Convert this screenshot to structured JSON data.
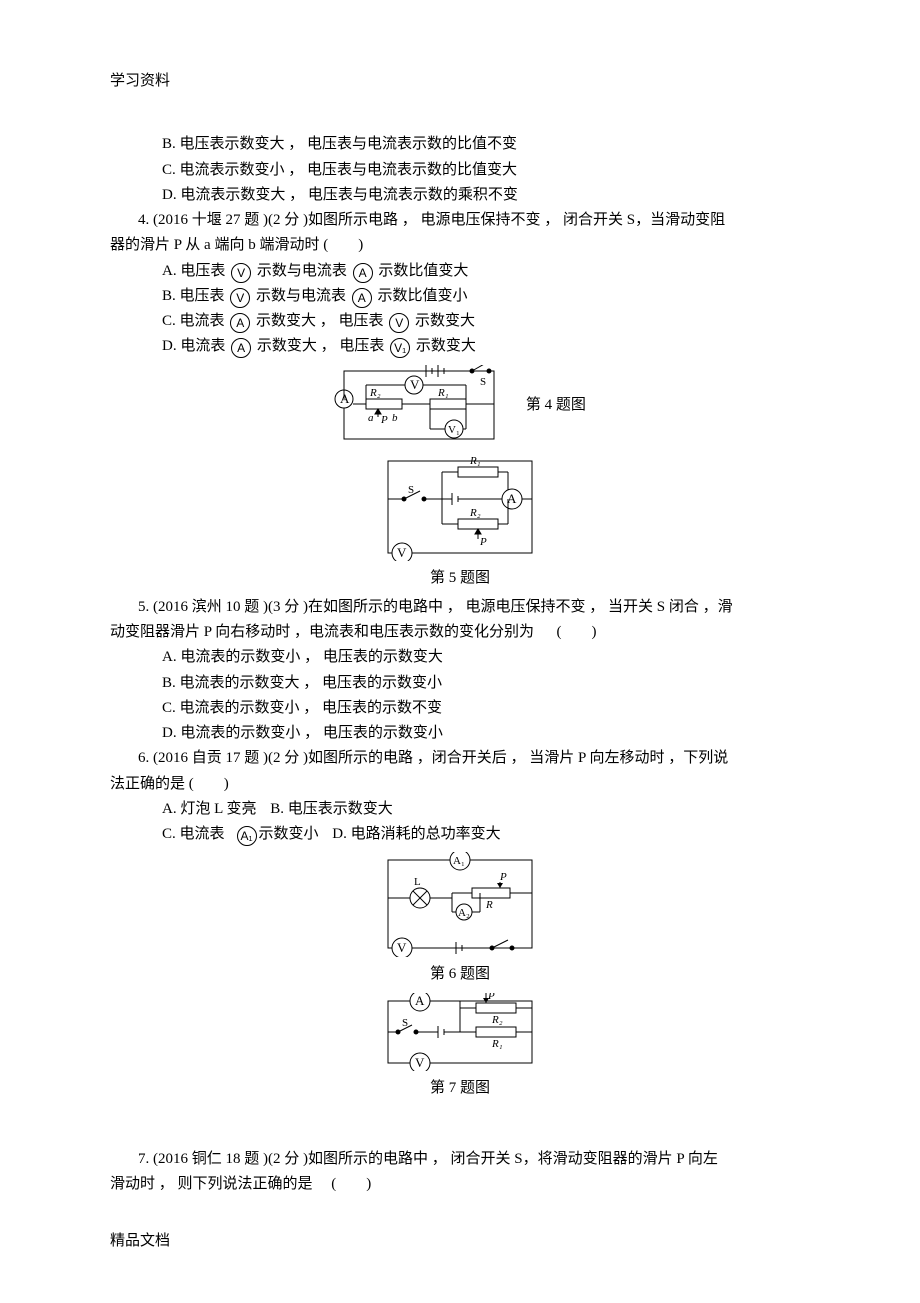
{
  "header": {
    "label": "学习资料"
  },
  "footer": {
    "label": "精品文档"
  },
  "q3": {
    "optB": "B.  电压表示数变大  ， 电压表与电流表示数的比值不变",
    "optC": "C.  电流表示数变小  ， 电压表与电流表示数的比值变大",
    "optD": "D.  电流表示数变大  ， 电压表与电流表示数的乘积不变"
  },
  "q4": {
    "stem1": "4. (2016 十堰  27 题 )(2 分 )如图所示电路  ， 电源电压保持不变  ， 闭合开关  S，当滑动变阻",
    "stem2": "器的滑片  P 从  a 端向  b  端滑动时 (　　)",
    "A1": "A.  电压表",
    "A2": "示数与电流表",
    "A3": "示数比值变大",
    "B1": "B.  电压表",
    "B2": "示数与电流表",
    "B3": "示数比值变小",
    "C1": "C.  电流表",
    "C2": "示数变大 ，  电压表",
    "C3": "示数变大",
    "D1": "D.  电流表",
    "D2": "示数变大 ，  电压表",
    "D3": "示数变大",
    "fig": "第  4 题图"
  },
  "q5": {
    "fig": "第 5 题图",
    "stem1": "5. (2016 滨州  10 题 )(3 分 )在如图所示的电路中  ， 电源电压保持不变  ， 当开关  S 闭合 ，滑",
    "stem2": "动变阻器滑片  P 向右移动时 ，电流表和电压表示数的变化分别为 　 (　　)",
    "A": "A.  电流表的示数变小  ，  电压表的示数变大",
    "B": "B.  电流表的示数变大  ，  电压表的示数变小",
    "C": "C.  电流表的示数变小  ，  电压表的示数不变",
    "D": "D.  电流表的示数变小  ，  电压表的示数变小"
  },
  "q6": {
    "stem1": "6. (2016 自贡  17 题 )(2 分 )如图所示的电路  ，闭合开关后 ， 当滑片  P 向左移动时  ，下列说",
    "stem2": "法正确的是 (　　)",
    "A": "A.  灯泡  L 变亮",
    "B": "B.  电压表示数变大",
    "C1": "C.  电流表",
    "C2": "示数变小",
    "D": "D.  电路消耗的总功率变大",
    "fig": "第  6 题图"
  },
  "q7": {
    "fig": "第  7 题图",
    "stem1": "7. (2016 铜仁  18 题 )(2 分 )如图所示的电路中  ， 闭合开关  S，将滑动变阻器的滑片  P 向左",
    "stem2": "滑动时 ， 则下列说法正确的是 　(　　)"
  },
  "symbols": {
    "V": "V",
    "A": "A",
    "V1": "V₁"
  }
}
